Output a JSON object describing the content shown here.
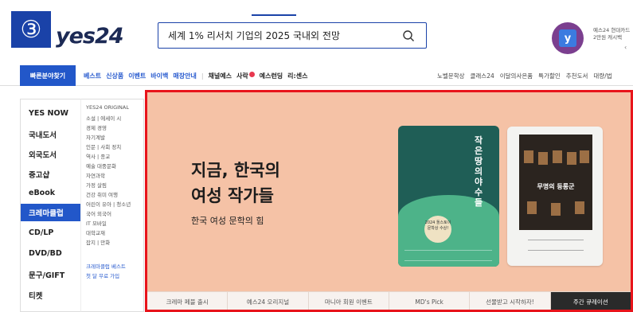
{
  "step_badge": "③",
  "logo": "yes24",
  "search": {
    "value": "세계 1% 리서치 기업의 2025 국내외 전망"
  },
  "ad": {
    "icon_letter": "y",
    "line1": "예스24 현대카드",
    "line2": "2만원 캐시백",
    "arrow": "‹"
  },
  "nav": {
    "quick": "빠른분야찾기",
    "left": [
      {
        "label": "베스트",
        "style": "blue"
      },
      {
        "label": "신상품",
        "style": "blue"
      },
      {
        "label": "이벤트",
        "style": "blue"
      },
      {
        "label": "바이백",
        "style": "blue"
      },
      {
        "label": "매장안내",
        "style": "blue"
      }
    ],
    "left2": [
      {
        "label": "채널예스",
        "style": "dark"
      },
      {
        "label": "사락",
        "style": "dark"
      },
      {
        "label": "예스런딩",
        "style": "dark"
      },
      {
        "label": "리:센스",
        "style": "dark"
      }
    ],
    "sep": "|",
    "right": [
      "노벨문학상",
      "클래스24",
      "이달의사은품",
      "특가할인",
      "추천도서",
      "대량/법"
    ]
  },
  "categories": [
    "YES NOW",
    "국내도서",
    "외국도서",
    "중고샵",
    "eBook",
    "크레마클럽",
    "CD/LP",
    "DVD/BD",
    "문구/GIFT",
    "티켓"
  ],
  "active_category": "크레마클럽",
  "subcategories": [
    "YES24 ORIGINAL",
    "소설 | 에세이 시",
    "경제 경영",
    "자기계발",
    "인문 | 사회 정치",
    "역사 | 종교",
    "예술 대중문화",
    "자연과학",
    "가정 살림",
    "건강 취미 여행",
    "어린이 유아 | 청소년",
    "국어 외국어",
    "IT 모바일",
    "대학교재",
    "잡지 | 만화"
  ],
  "subcategory_links": [
    "크레마클럽 베스트",
    "첫 달 무료 가입"
  ],
  "banner": {
    "title_line1": "지금, 한국의",
    "title_line2": "여성 작가들",
    "subtitle": "한국 여성 문학의 힘",
    "book1": {
      "title": "작은 땅의 야수들",
      "stamp": "2024 톨스토이문학상 수상!"
    },
    "book2": {
      "title": "무명의 등롱군"
    },
    "tabs": [
      "크레마 페블 출시",
      "예스24 오리지널",
      "마니아 회원 이벤트",
      "MD's Pick",
      "선물받고 시작하자!",
      "주간 큐레이션"
    ],
    "active_tab": "주간 큐레이션"
  }
}
